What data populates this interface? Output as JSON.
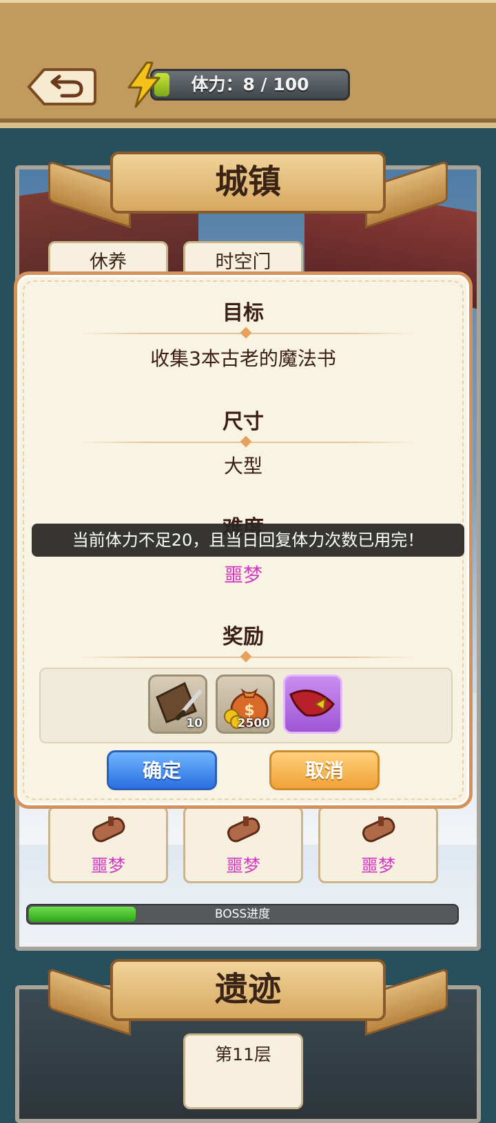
{
  "header": {
    "stamina_label": "体力：8 / 100",
    "stamina": {
      "current": 8,
      "max": 100
    }
  },
  "town": {
    "title": "城镇",
    "top_tabs": [
      "休养",
      "时空门"
    ],
    "bottom_cards": [
      "噩梦",
      "噩梦",
      "噩梦"
    ],
    "boss_label": "BOSS进度",
    "boss_progress": 0.25
  },
  "dialog": {
    "goal_heading": "目标",
    "goal_value": "收集3本古老的魔法书",
    "size_heading": "尺寸",
    "size_value": "大型",
    "difficulty_heading": "难度",
    "difficulty_value": "噩梦",
    "reward_heading": "奖励",
    "rewards": [
      {
        "icon": "leather-knife-icon",
        "qty": "10"
      },
      {
        "icon": "money-bag-icon",
        "qty": "2500"
      },
      {
        "icon": "red-belt-icon",
        "qty": ""
      }
    ],
    "confirm_label": "确定",
    "cancel_label": "取消"
  },
  "toast": "当前体力不足20，且当日回复体力次数已用完！",
  "ruins": {
    "title": "遗迹",
    "floor_label": "第11层"
  },
  "colors": {
    "difficulty": "#d23ac3",
    "confirm": "#2a6fe0",
    "cancel": "#f0a23a"
  }
}
